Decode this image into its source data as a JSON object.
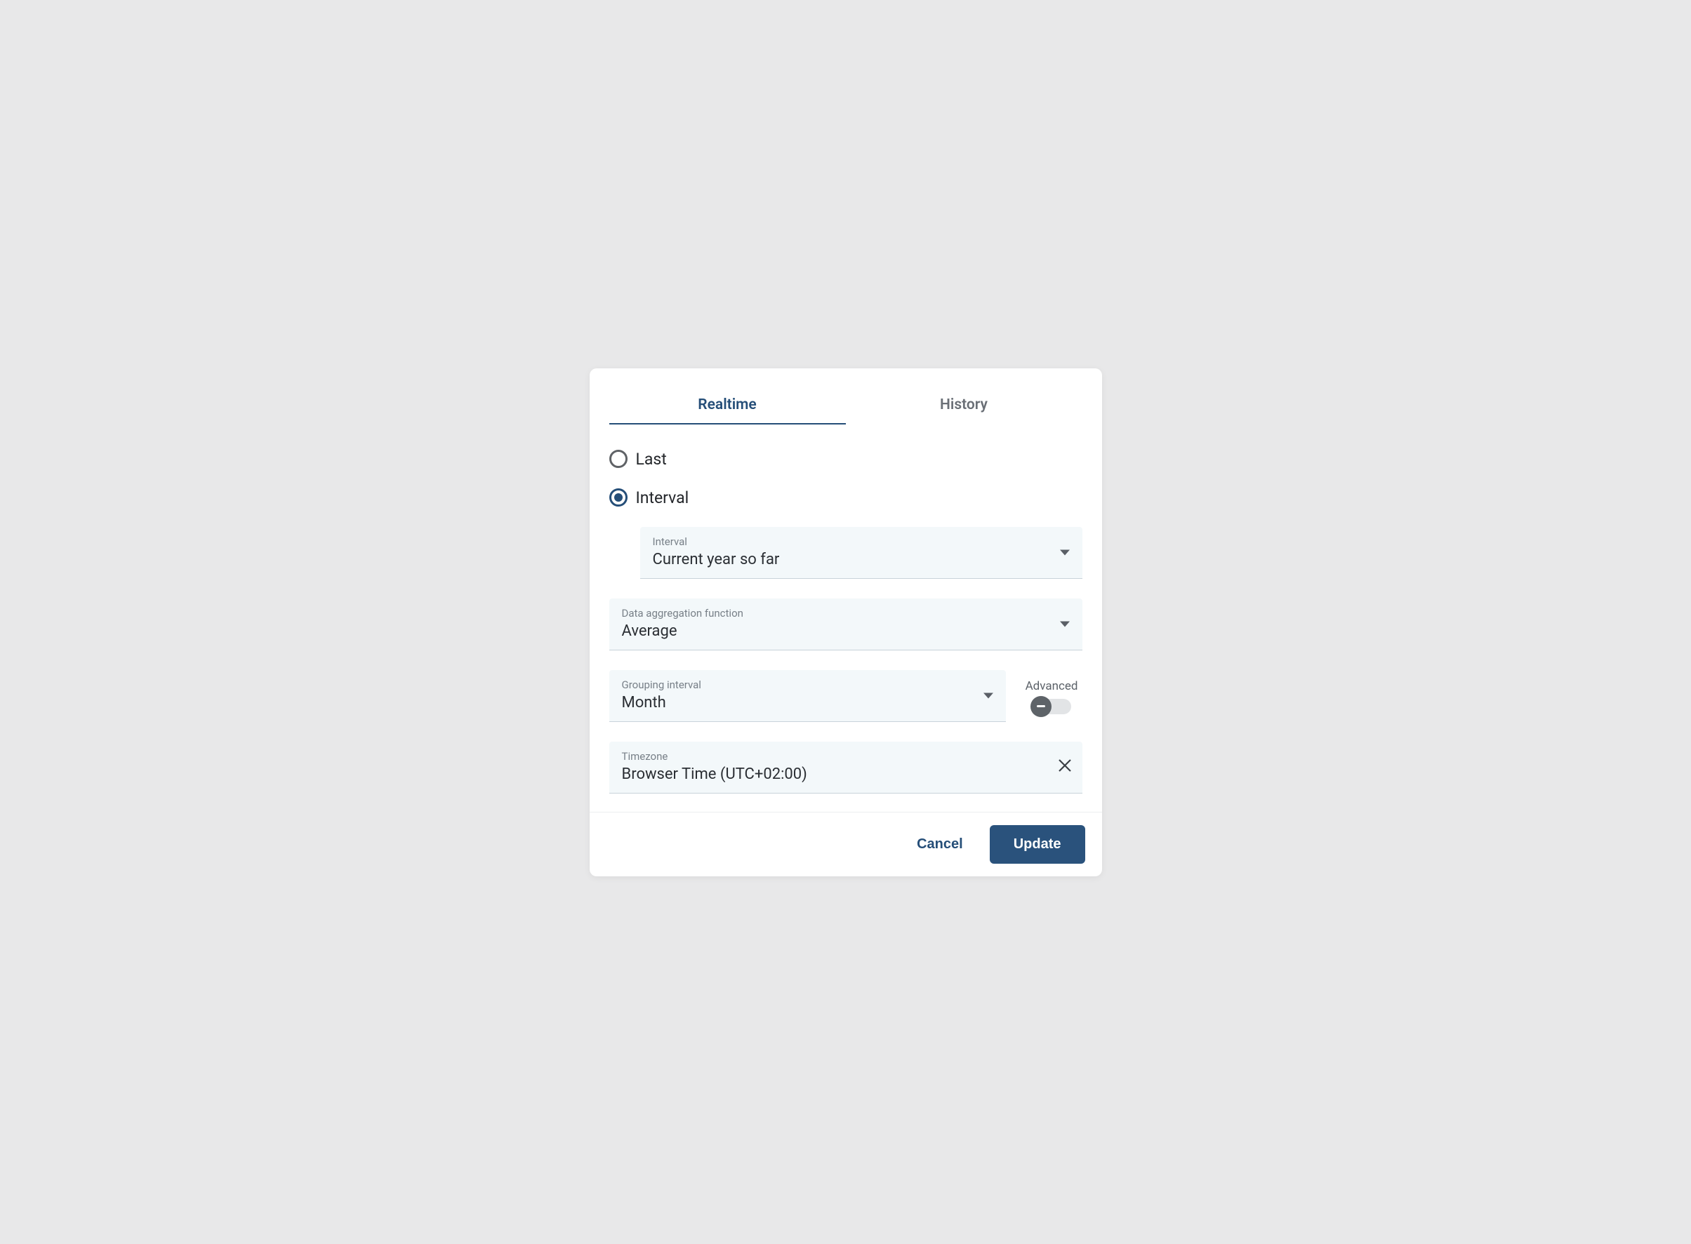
{
  "tabs": {
    "realtime": "Realtime",
    "history": "History"
  },
  "radios": {
    "last": "Last",
    "interval": "Interval"
  },
  "fields": {
    "interval": {
      "label": "Interval",
      "value": "Current year so far"
    },
    "aggregation": {
      "label": "Data aggregation function",
      "value": "Average"
    },
    "grouping": {
      "label": "Grouping interval",
      "value": "Month"
    },
    "advanced": {
      "label": "Advanced"
    },
    "timezone": {
      "label": "Timezone",
      "value": "Browser Time (UTC+02:00)"
    }
  },
  "footer": {
    "cancel": "Cancel",
    "update": "Update"
  }
}
